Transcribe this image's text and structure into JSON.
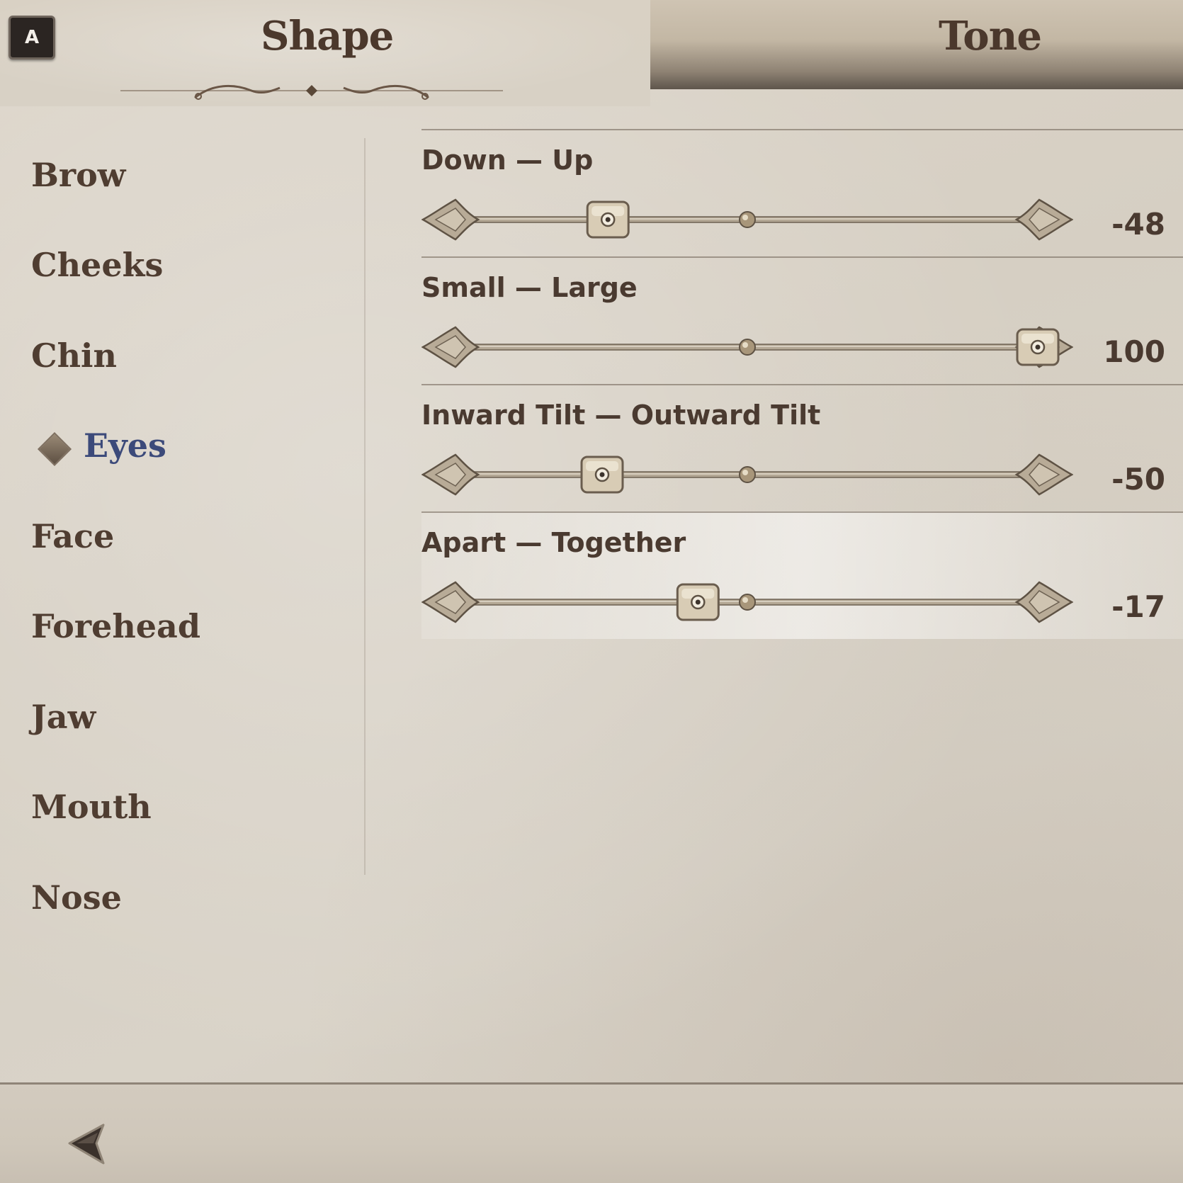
{
  "header": {
    "controller_key": "A",
    "tabs": [
      {
        "label": "Shape",
        "active": true
      },
      {
        "label": "Tone",
        "active": false
      }
    ]
  },
  "sidebar": {
    "items": [
      {
        "label": "Brow",
        "active": false
      },
      {
        "label": "Cheeks",
        "active": false
      },
      {
        "label": "Chin",
        "active": false
      },
      {
        "label": "Eyes",
        "active": true
      },
      {
        "label": "Face",
        "active": false
      },
      {
        "label": "Forehead",
        "active": false
      },
      {
        "label": "Jaw",
        "active": false
      },
      {
        "label": "Mouth",
        "active": false
      },
      {
        "label": "Nose",
        "active": false
      }
    ]
  },
  "sliders": {
    "min": -100,
    "max": 100,
    "items": [
      {
        "label": "Down — Up",
        "value": "-48",
        "highlighted": false
      },
      {
        "label": "Small — Large",
        "value": "100",
        "highlighted": false
      },
      {
        "label": "Inward Tilt — Outward Tilt",
        "value": "-50",
        "highlighted": false
      },
      {
        "label": "Apart — Together",
        "value": "-17",
        "highlighted": true
      }
    ]
  },
  "footer": {
    "back_icon": "back-arrow-icon"
  },
  "colors": {
    "text": "#4a3a30",
    "active_category": "#3c4a7a",
    "parchment": "#d9d3c8"
  }
}
